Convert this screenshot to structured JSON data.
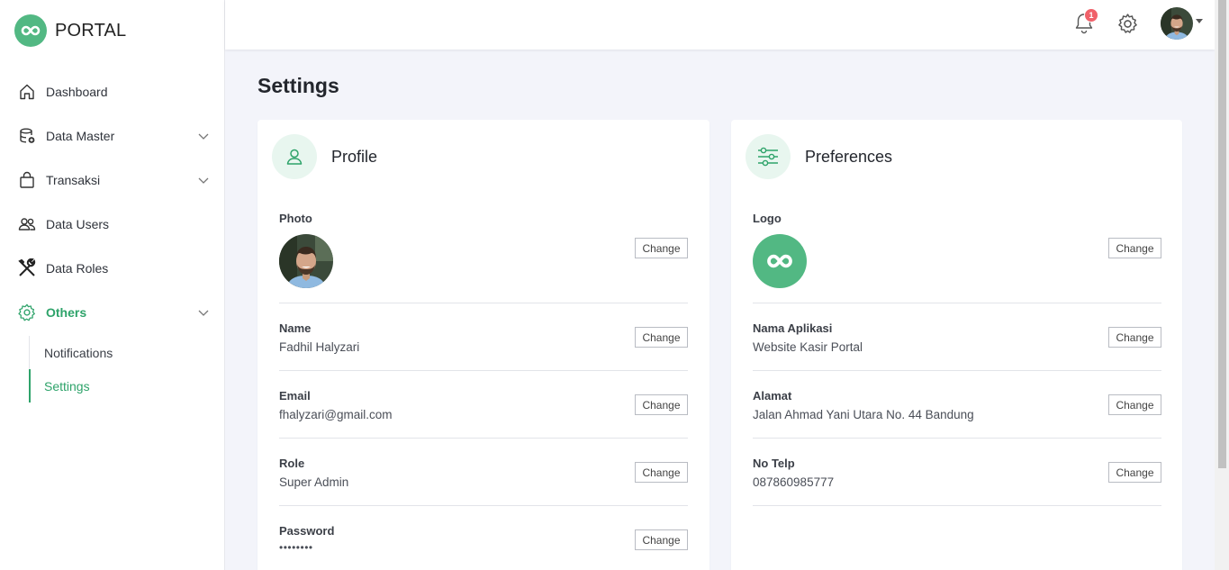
{
  "brand": {
    "name": "PORTAL",
    "accent": "#52b883"
  },
  "sidebar": {
    "items": [
      {
        "label": "Dashboard",
        "icon": "home-icon"
      },
      {
        "label": "Data Master",
        "icon": "database-icon",
        "expandable": true
      },
      {
        "label": "Transaksi",
        "icon": "shopping-bag-icon",
        "expandable": true
      },
      {
        "label": "Data Users",
        "icon": "users-icon"
      },
      {
        "label": "Data Roles",
        "icon": "tools-icon"
      },
      {
        "label": "Others",
        "icon": "gear-icon",
        "expandable": true,
        "active": true
      }
    ],
    "subitems": [
      {
        "label": "Notifications"
      },
      {
        "label": "Settings",
        "active": true
      }
    ]
  },
  "topbar": {
    "notification_count": "1"
  },
  "page": {
    "title": "Settings"
  },
  "profile": {
    "title": "Profile",
    "photo_label": "Photo",
    "fields": [
      {
        "label": "Name",
        "value": "Fadhil Halyzari"
      },
      {
        "label": "Email",
        "value": "fhalyzari@gmail.com"
      },
      {
        "label": "Role",
        "value": "Super Admin"
      },
      {
        "label": "Password",
        "value": "••••••••"
      }
    ]
  },
  "preferences": {
    "title": "Preferences",
    "logo_label": "Logo",
    "fields": [
      {
        "label": "Nama Aplikasi",
        "value": "Website Kasir Portal"
      },
      {
        "label": "Alamat",
        "value": "Jalan Ahmad Yani Utara No. 44 Bandung"
      },
      {
        "label": "No Telp",
        "value": "087860985777"
      }
    ]
  },
  "change_label": "Change"
}
